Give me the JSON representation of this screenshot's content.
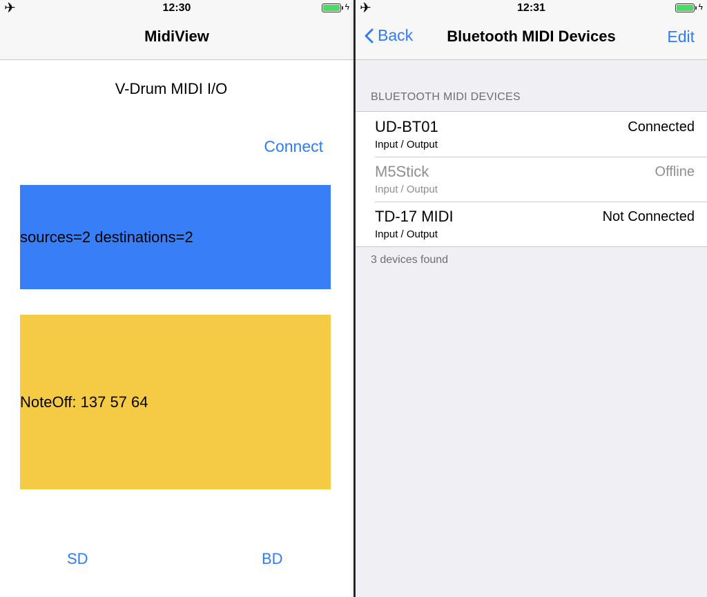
{
  "left": {
    "status_time": "12:30",
    "nav_title": "MidiView",
    "heading": "V-Drum MIDI I/O",
    "connect_label": "Connect",
    "midi_counts_text": "sources=2 destinations=2",
    "last_message_text": "NoteOff: 137 57 64",
    "sd_label": "SD",
    "bd_label": "BD"
  },
  "right": {
    "status_time": "12:31",
    "back_label": "Back",
    "nav_title": "Bluetooth MIDI Devices",
    "edit_label": "Edit",
    "section_header": "BLUETOOTH MIDI DEVICES",
    "devices": [
      {
        "name": "UD-BT01",
        "ports": "Input / Output",
        "status": "Connected"
      },
      {
        "name": "M5Stick",
        "ports": "Input / Output",
        "status": "Offline"
      },
      {
        "name": "TD-17 MIDI",
        "ports": "Input / Output",
        "status": "Not Connected"
      }
    ],
    "footer": "3 devices found"
  },
  "colors": {
    "accent": "#2f7cf6",
    "blue_panel": "#387ef6",
    "yellow_panel": "#f5cb45",
    "battery": "#4cd964"
  },
  "icons": [
    "airplane-icon",
    "battery-icon",
    "charging-bolt-icon",
    "chevron-left-icon"
  ]
}
